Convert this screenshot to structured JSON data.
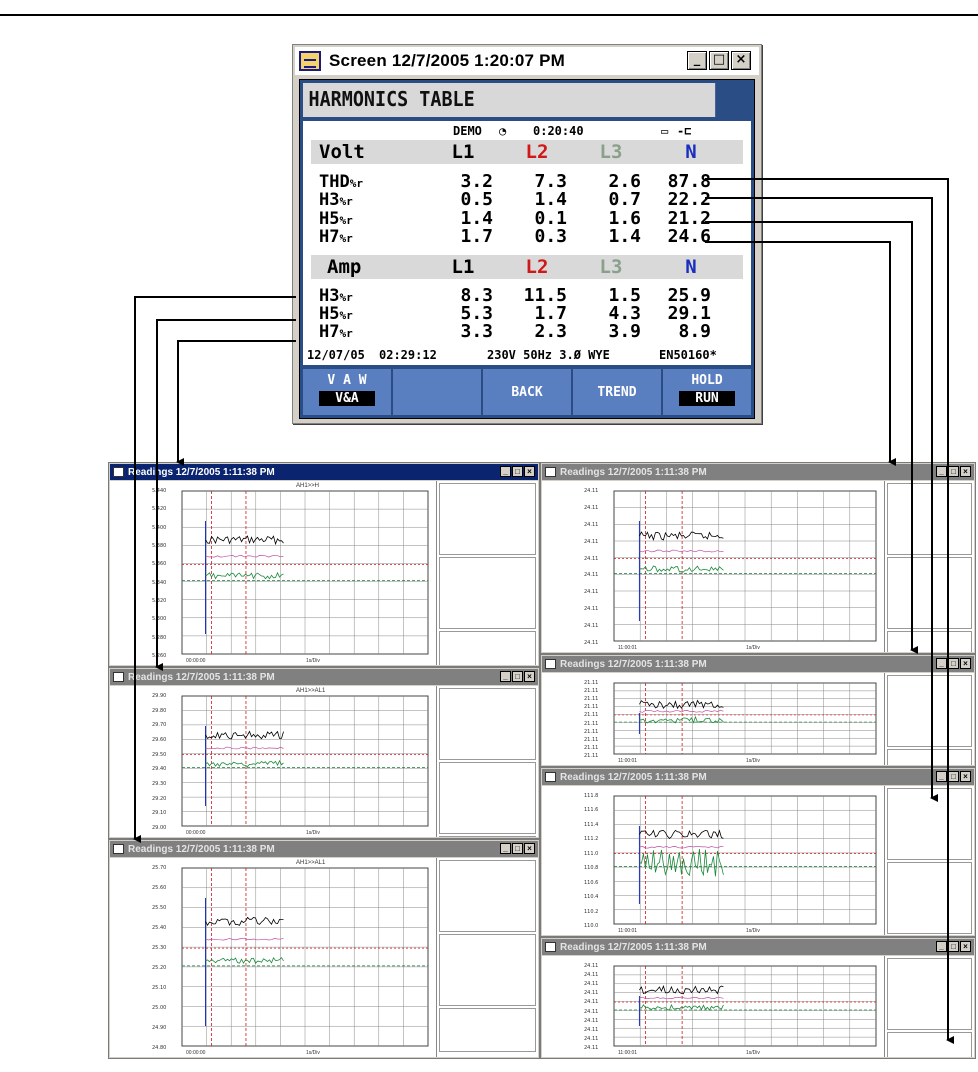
{
  "main_window": {
    "title": "Screen 12/7/2005  1:20:07 PM",
    "buttons": {
      "minimize": "_",
      "maximize": "□",
      "close": "×"
    },
    "header": "HARMONICS TABLE",
    "status": {
      "mode": "DEMO",
      "timer_icon": "timer-icon",
      "elapsed": "0:20:40",
      "battery_icon": "battery-icon",
      "plug_icon": "plug-icon"
    },
    "volt": {
      "section": "Volt",
      "cols": [
        "L1",
        "L2",
        "L3",
        "N"
      ],
      "rows": [
        {
          "label": "THD",
          "unit": "%r",
          "values": [
            "3.2",
            "7.3",
            "2.6",
            "87.8"
          ]
        },
        {
          "label": "H3",
          "unit": "%r",
          "values": [
            "0.5",
            "1.4",
            "0.7",
            "22.2"
          ]
        },
        {
          "label": "H5",
          "unit": "%r",
          "values": [
            "1.4",
            "0.1",
            "1.6",
            "21.2"
          ]
        },
        {
          "label": "H7",
          "unit": "%r",
          "values": [
            "1.7",
            "0.3",
            "1.4",
            "24.6"
          ]
        }
      ]
    },
    "amp": {
      "section": "Amp",
      "cols": [
        "L1",
        "L2",
        "L3",
        "N"
      ],
      "rows": [
        {
          "label": "H3",
          "unit": "%r",
          "values": [
            "8.3",
            "11.5",
            "1.5",
            "25.9"
          ]
        },
        {
          "label": "H5",
          "unit": "%r",
          "values": [
            "5.3",
            "1.7",
            "4.3",
            "29.1"
          ]
        },
        {
          "label": "H7",
          "unit": "%r",
          "values": [
            "3.3",
            "2.3",
            "3.9",
            "8.9"
          ]
        }
      ]
    },
    "footer": {
      "date": "12/07/05",
      "time": "02:29:12",
      "config": "230V  50Hz 3.Ø WYE",
      "standard": "EN50160*"
    },
    "softkeys": [
      {
        "top": "V  A  W",
        "bottom": "V&A"
      },
      {
        "single": ""
      },
      {
        "single": "BACK"
      },
      {
        "single": "TREND"
      },
      {
        "top": "HOLD",
        "bottom": "RUN"
      }
    ]
  },
  "readings_windows": [
    {
      "title": "Readings 12/7/2005  1:11:38 PM",
      "plot_title": "AH1>>H",
      "active": true,
      "y_ticks": [
        "5.440",
        "5.420",
        "5.400",
        "5.380",
        "5.360",
        "5.340",
        "5.320",
        "5.300",
        "5.280",
        "5.260"
      ],
      "x_labels": [
        "00:00:00",
        "1s/Div"
      ]
    },
    {
      "title": "Readings 12/7/2005  1:11:38 PM",
      "plot_title": "AH1>>AL1",
      "active": false,
      "y_ticks": [
        "29.90",
        "29.80",
        "29.70",
        "29.60",
        "29.50",
        "29.40",
        "29.30",
        "29.20",
        "29.10",
        "29.00"
      ],
      "x_labels": [
        "00:00:00",
        "1s/Div"
      ]
    },
    {
      "title": "Readings 12/7/2005  1:11:38 PM",
      "plot_title": "AH1>>AL1",
      "active": false,
      "y_ticks": [
        "25.70",
        "25.60",
        "25.50",
        "25.40",
        "25.30",
        "25.20",
        "25.10",
        "25.00",
        "24.90",
        "24.80"
      ],
      "x_labels": [
        "00:00:00",
        "1s/Div"
      ]
    },
    {
      "title": "Readings 12/7/2005  1:11:38 PM",
      "plot_title": "",
      "active": false,
      "y_ticks": [
        "24.11",
        "24.11",
        "24.11",
        "24.11",
        "24.11",
        "24.11",
        "24.11",
        "24.11",
        "24.11",
        "24.11"
      ],
      "x_labels": [
        "11:00:01",
        "1s/Div"
      ]
    },
    {
      "title": "Readings 12/7/2005  1:11:38 PM",
      "plot_title": "",
      "active": false,
      "y_ticks": [
        "21.11",
        "21.11",
        "21.11",
        "21.11",
        "21.11",
        "21.11",
        "21.11",
        "21.11",
        "21.11",
        "21.11"
      ],
      "x_labels": [
        "11:00:01",
        "1s/Div"
      ]
    },
    {
      "title": "Readings 12/7/2005  1:11:38 PM",
      "plot_title": "",
      "active": false,
      "y_ticks": [
        "111.8",
        "111.6",
        "111.4",
        "111.2",
        "111.0",
        "110.8",
        "110.6",
        "110.4",
        "110.2",
        "110.0"
      ],
      "x_labels": [
        "11:00:01",
        "1s/Div"
      ]
    },
    {
      "title": "Readings 12/7/2005  1:11:38 PM",
      "plot_title": "",
      "active": false,
      "y_ticks": [
        "24.11",
        "24.11",
        "24.11",
        "24.11",
        "24.11",
        "24.11",
        "24.11",
        "24.11",
        "24.11",
        "24.11"
      ],
      "x_labels": [
        "11:00:01",
        "1s/Div"
      ]
    }
  ],
  "colors": {
    "screen_bg": "#2b4d86",
    "softkey": "#5a7fc0",
    "l2": "#d01818",
    "l3": "#8aa08a",
    "n": "#1a2ec0",
    "active_title": "#0a2470"
  }
}
